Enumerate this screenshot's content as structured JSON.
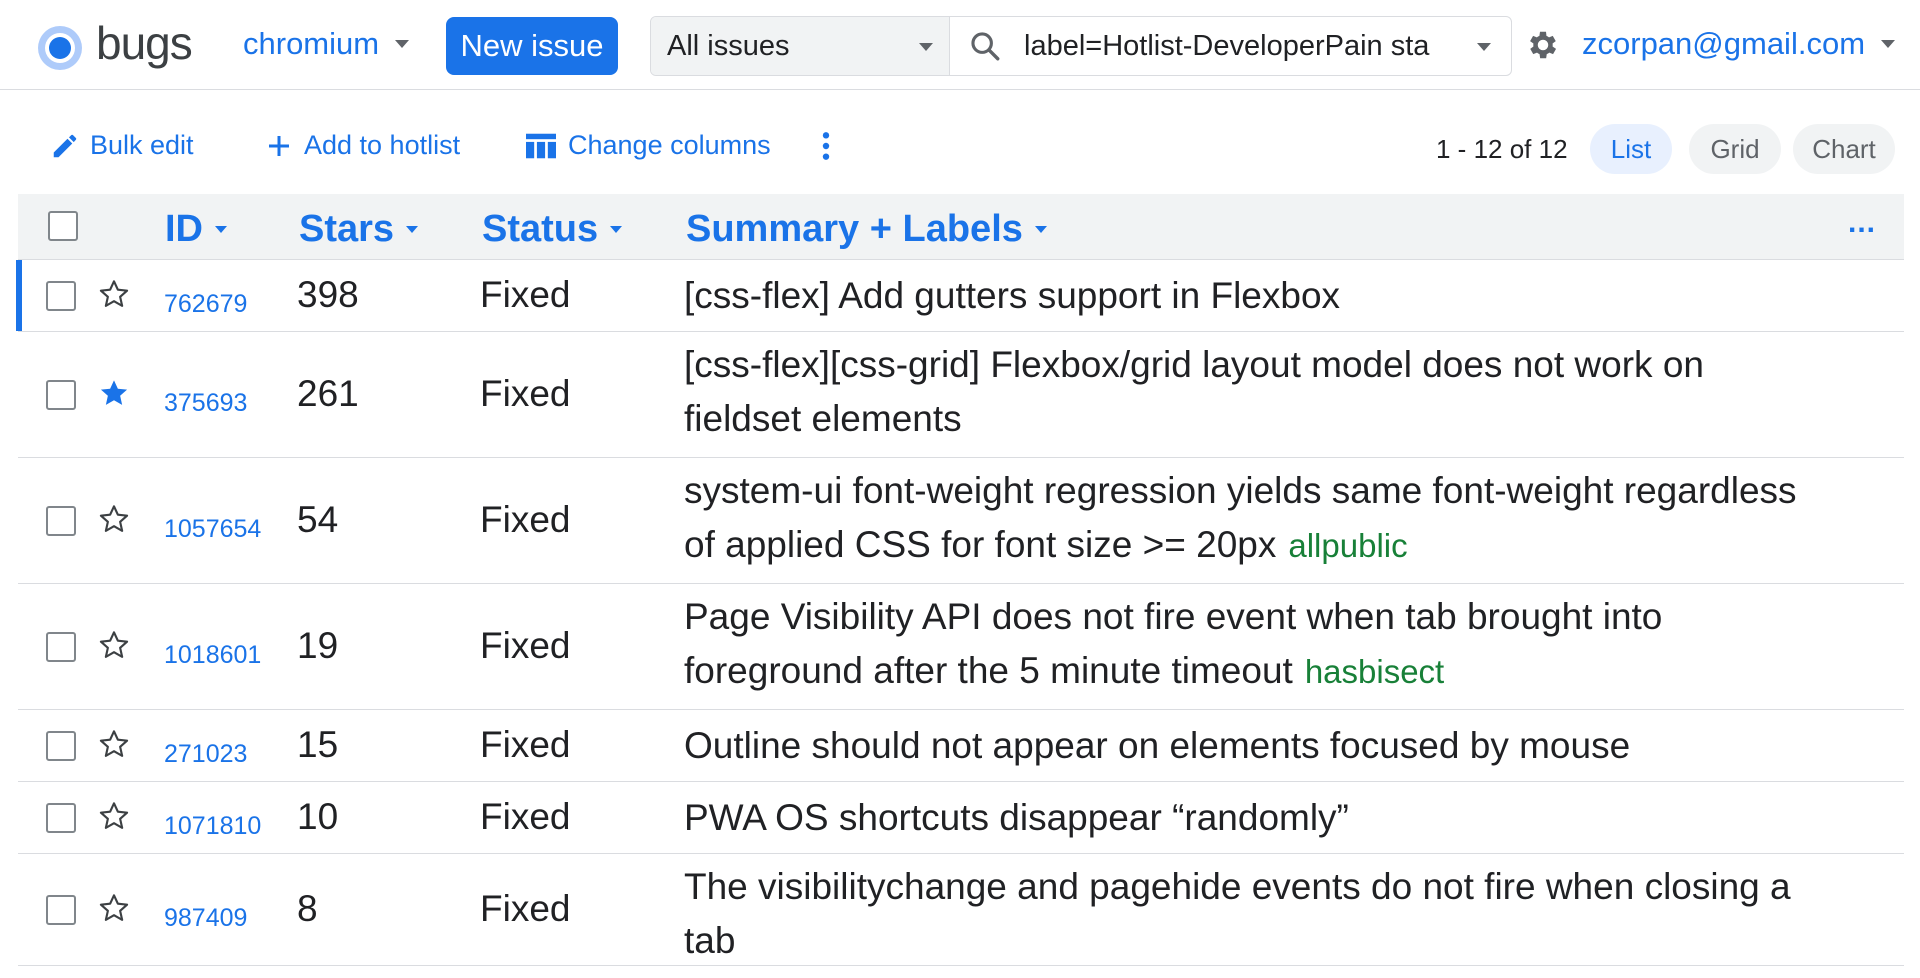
{
  "header": {
    "logo_text": "bugs",
    "project": "chromium",
    "new_issue_label": "New issue",
    "scope": "All issues",
    "query": "label=Hotlist-DeveloperPain sta",
    "account": "zcorpan@gmail.com"
  },
  "toolbar": {
    "bulk_edit": "Bulk edit",
    "add_to_hotlist": "Add to hotlist",
    "change_columns": "Change columns",
    "pager": "1 - 12 of 12",
    "views": [
      "List",
      "Grid",
      "Chart"
    ],
    "active_view": "List"
  },
  "table": {
    "columns": [
      "ID",
      "Stars",
      "Status",
      "Summary + Labels"
    ],
    "more_label": "...",
    "rows": [
      {
        "id": "762679",
        "starred": false,
        "stars": "398",
        "status": "Fixed",
        "summary": "[css-flex] Add gutters support in Flexbox",
        "labels": ""
      },
      {
        "id": "375693",
        "starred": true,
        "stars": "261",
        "status": "Fixed",
        "summary": "[css-flex][css-grid] Flexbox/grid layout model does not work on fieldset elements",
        "labels": ""
      },
      {
        "id": "1057654",
        "starred": false,
        "stars": "54",
        "status": "Fixed",
        "summary": "system-ui font-weight regression yields same font-weight regardless of applied CSS for font size >= 20px",
        "labels": "allpublic"
      },
      {
        "id": "1018601",
        "starred": false,
        "stars": "19",
        "status": "Fixed",
        "summary": "Page Visibility API does not fire event when tab brought into foreground after the 5 minute timeout",
        "labels": "hasbisect"
      },
      {
        "id": "271023",
        "starred": false,
        "stars": "15",
        "status": "Fixed",
        "summary": "Outline should not appear on elements focused by mouse",
        "labels": ""
      },
      {
        "id": "1071810",
        "starred": false,
        "stars": "10",
        "status": "Fixed",
        "summary": "PWA OS shortcuts disappear “randomly”",
        "labels": ""
      },
      {
        "id": "987409",
        "starred": false,
        "stars": "8",
        "status": "Fixed",
        "summary": "The visibilitychange and pagehide events do not fire when closing a tab",
        "labels": ""
      }
    ]
  },
  "colors": {
    "accent": "#1a73e8",
    "label": "#188038",
    "header_bg": "#f1f3f4"
  }
}
